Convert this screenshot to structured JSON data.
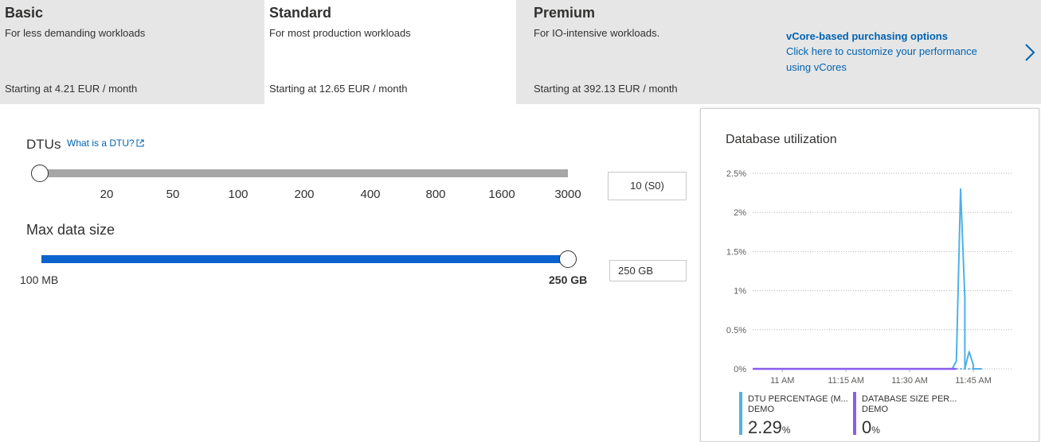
{
  "tiers": [
    {
      "name": "Basic",
      "desc": "For less demanding workloads",
      "price": "Starting at 4.21 EUR / month",
      "selected": false
    },
    {
      "name": "Standard",
      "desc": "For most production workloads",
      "price": "Starting at 12.65 EUR / month",
      "selected": true
    },
    {
      "name": "Premium",
      "desc": "For IO-intensive workloads.",
      "price": "Starting at 392.13 EUR / month",
      "selected": false
    }
  ],
  "vcore": {
    "title": "vCore-based purchasing options",
    "text": "Click here to customize your performance using vCores"
  },
  "dtu": {
    "label": "DTUs",
    "link": "What is a DTU?",
    "ticks": [
      "20",
      "50",
      "100",
      "200",
      "400",
      "800",
      "1600",
      "3000"
    ],
    "value": "10 (S0)",
    "position": 0
  },
  "size": {
    "label": "Max data size",
    "min": "100 MB",
    "max": "250 GB",
    "value": "250 GB",
    "position": 1
  },
  "colors": {
    "accent": "#0063b1",
    "slider_fill": "#0b63ce",
    "slider_track": "#a6a6a6",
    "dtu_series": "#4fb1e6",
    "db_series": "#8a5cf0",
    "tier_bg": "#e6e6e6"
  },
  "chart": {
    "title": "Database utilization",
    "legend": [
      {
        "name": "DTU PERCENTAGE (M...",
        "sub": "DEMO",
        "value": "2.29",
        "unit": "%"
      },
      {
        "name": "DATABASE SIZE PER...",
        "sub": "DEMO",
        "value": "0",
        "unit": "%"
      }
    ]
  },
  "chart_data": {
    "type": "line",
    "title": "Database utilization",
    "y_ticks": [
      "2.5%",
      "2%",
      "1.5%",
      "1%",
      "0.5%",
      "0%"
    ],
    "x_ticks": [
      "11 AM",
      "11:15 AM",
      "11:30 AM",
      "11:45 AM"
    ],
    "ylim": [
      0,
      2.5
    ],
    "xlim": [
      "10:53",
      "11:54"
    ],
    "grid": true,
    "series": [
      {
        "name": "DTU PERCENTAGE (M...",
        "x": [
          "10:53",
          "11:40",
          "11:41",
          "11:42",
          "11:43",
          "11:43",
          "11:44",
          "11:45",
          "11:45",
          "11:47"
        ],
        "values": [
          0,
          0,
          0.1,
          2.3,
          0.9,
          0,
          0.22,
          0.05,
          0,
          0
        ]
      },
      {
        "name": "DATABASE SIZE PER...",
        "x": [
          "10:53",
          "11:41"
        ],
        "values": [
          0,
          0
        ]
      }
    ]
  }
}
